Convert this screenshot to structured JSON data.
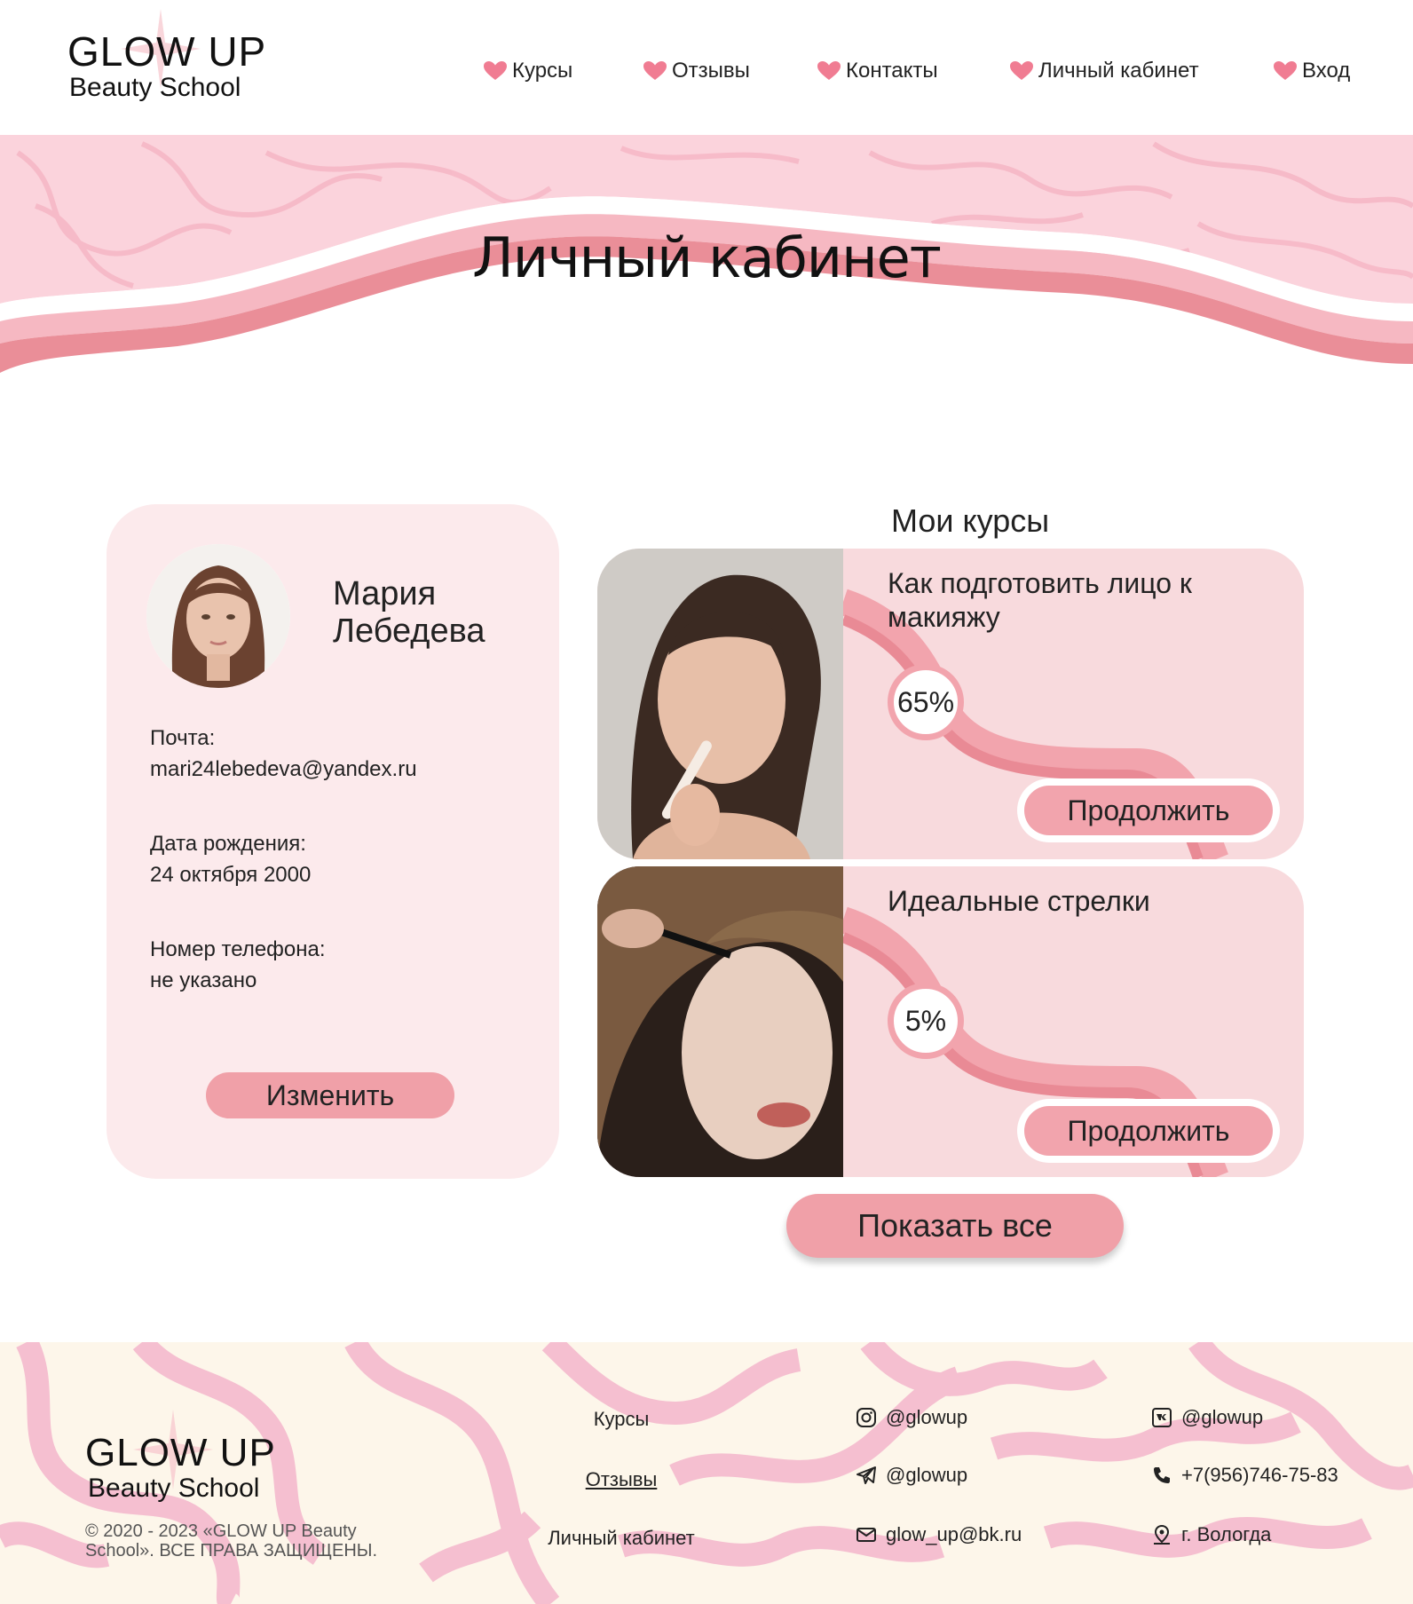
{
  "brand": {
    "title": "GLOW UP",
    "subtitle": "Beauty School"
  },
  "nav": [
    {
      "label": "Курсы"
    },
    {
      "label": "Отзывы"
    },
    {
      "label": "Контакты"
    },
    {
      "label": "Личный кабинет"
    },
    {
      "label": "Вход"
    }
  ],
  "page_title": "Личный кабинет",
  "profile": {
    "name_first": "Мария",
    "name_last": "Лебедева",
    "email_label": "Почта:",
    "email": "mari24lebedeva@yandex.ru",
    "birth_label": "Дата рождения:",
    "birth": "24 октября 2000",
    "phone_label": "Номер телефона:",
    "phone": "не указано",
    "edit_button": "Изменить"
  },
  "courses": {
    "title": "Мои курсы",
    "items": [
      {
        "title": "Как подготовить лицо к макияжу",
        "progress": "65%",
        "continue_label": "Продолжить"
      },
      {
        "title": "Идеальные стрелки",
        "progress": "5%",
        "continue_label": "Продолжить"
      }
    ],
    "show_all": "Показать все"
  },
  "footer": {
    "copyright": "© 2020 - 2023 «GLOW UP Beauty School». ВСЕ ПРАВА ЗАЩИЩЕНЫ.",
    "links": [
      "Курсы",
      "Отзывы",
      "Личный кабинет"
    ],
    "contacts": {
      "instagram": "@glowup",
      "telegram": "@glowup",
      "email": "glow_up@bk.ru",
      "vk": "@glowup",
      "phone": "+7(956)746-75-83",
      "location": "г. Вологда"
    }
  },
  "colors": {
    "accent": "#f0a0a8",
    "card": "#fceaec",
    "course_card": "#f8dadd",
    "banner": "#fbd3dc",
    "footer_bg": "#fdf6ea"
  },
  "icons": [
    "heart-icon",
    "star-sparkle-icon",
    "instagram-icon",
    "telegram-icon",
    "mail-icon",
    "vk-icon",
    "phone-icon",
    "location-icon"
  ]
}
